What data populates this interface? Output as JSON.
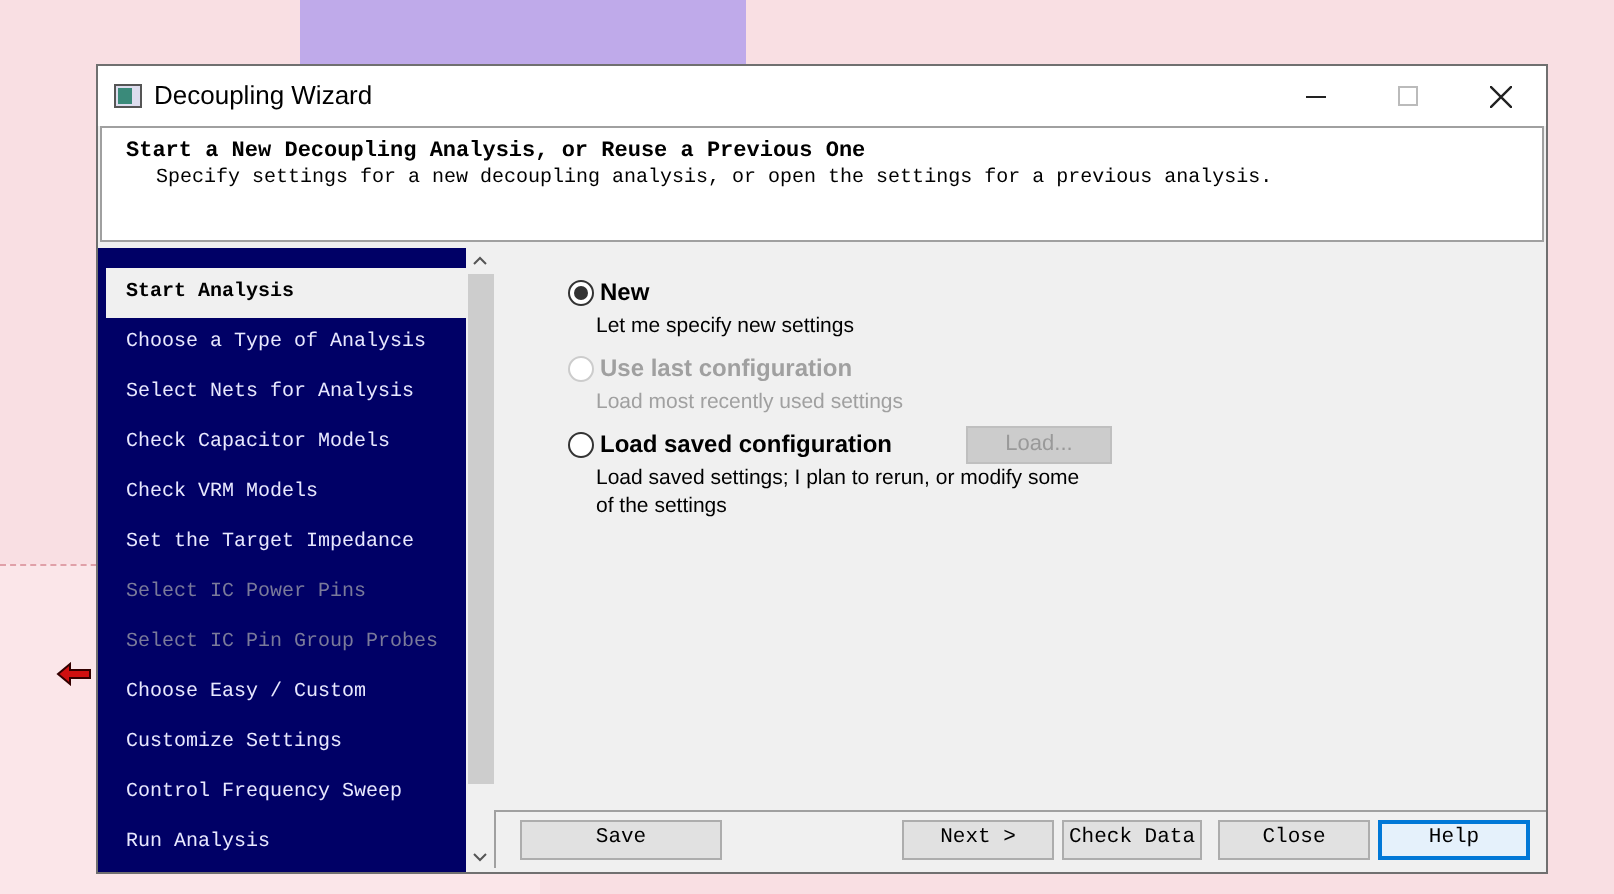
{
  "window": {
    "title": "Decoupling Wizard"
  },
  "header": {
    "title": "Start a New Decoupling Analysis, or Reuse a Previous One",
    "subtitle": "Specify settings for a new decoupling analysis, or open the settings for a previous analysis."
  },
  "steps": [
    {
      "label": "Start Analysis",
      "selected": true,
      "disabled": false
    },
    {
      "label": "Choose a Type of Analysis",
      "selected": false,
      "disabled": false
    },
    {
      "label": "Select Nets for Analysis",
      "selected": false,
      "disabled": false
    },
    {
      "label": "Check Capacitor Models",
      "selected": false,
      "disabled": false
    },
    {
      "label": "Check VRM Models",
      "selected": false,
      "disabled": false
    },
    {
      "label": "Set the Target Impedance",
      "selected": false,
      "disabled": false
    },
    {
      "label": "Select IC Power Pins",
      "selected": false,
      "disabled": true
    },
    {
      "label": "Select IC Pin Group Probes",
      "selected": false,
      "disabled": true
    },
    {
      "label": "Choose Easy / Custom",
      "selected": false,
      "disabled": false
    },
    {
      "label": "Customize Settings",
      "selected": false,
      "disabled": false
    },
    {
      "label": "Control Frequency Sweep",
      "selected": false,
      "disabled": false
    },
    {
      "label": "Run Analysis",
      "selected": false,
      "disabled": false
    }
  ],
  "options": [
    {
      "label": "New",
      "description": "Let me specify new settings",
      "selected": true,
      "disabled": false
    },
    {
      "label": "Use last configuration",
      "description": "Load most recently used settings",
      "selected": false,
      "disabled": true
    },
    {
      "label": "Load saved configuration",
      "description": "Load saved settings; I plan to rerun, or modify some of the settings",
      "selected": false,
      "disabled": false,
      "button": {
        "label": "Load...",
        "disabled": true
      }
    }
  ],
  "buttons": [
    {
      "label": "Save",
      "focused": false
    },
    {
      "label": "Next >",
      "focused": false
    },
    {
      "label": "Check Data",
      "focused": false
    },
    {
      "label": "Close",
      "focused": false
    },
    {
      "label": "Help",
      "focused": true
    }
  ]
}
